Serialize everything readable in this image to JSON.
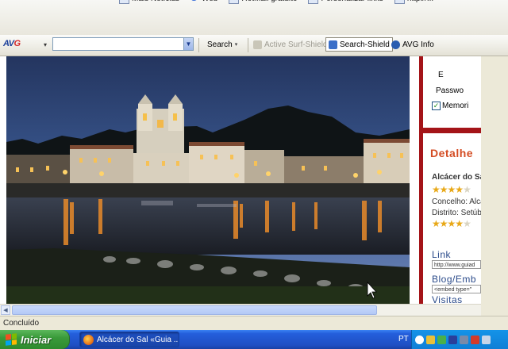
{
  "links_bar": {
    "items": [
      {
        "label": "Mais Notícias",
        "icon": "page-icon"
      },
      {
        "label": "Web",
        "icon": "google-icon"
      },
      {
        "label": "HotMail gratuito",
        "icon": "page-icon"
      },
      {
        "label": "Personalizar links",
        "icon": "page-icon"
      },
      {
        "label": "http://...",
        "icon": "page-icon"
      }
    ]
  },
  "toolbar": {
    "logo_prefix": "AV",
    "logo_suffix": "G",
    "logo_menu": "▾",
    "search_placeholder": "",
    "search_button": "Search",
    "surf_shield": "Active Surf-Shield",
    "search_shield": "Search-Shield",
    "avg_info": "AVG Info"
  },
  "sidebar": {
    "login_label_partial": "E",
    "password_label": "Passwo",
    "remember_label": "Memori",
    "remember_checked": true,
    "details_title": "Detalhe",
    "place_name": "Alcácer do Sa",
    "rating_1": 4,
    "concelho": "Concelho: Alca",
    "distrito": "Distrito: Setúb",
    "rating_2": 4,
    "rating_max": 5,
    "link_heading": "Link",
    "link_value": "http://www.guiad",
    "embed_heading": "Blog/Emb",
    "embed_value": "<embed type=\"",
    "visits_heading": "Visitas"
  },
  "statusbar": {
    "text": "Concluído"
  },
  "taskbar": {
    "start_label": "Iniciar",
    "window_title": "Alcácer do Sal «Guia ...",
    "language": "PT"
  },
  "colors": {
    "sidebar_red": "#a41418",
    "details_orange": "#d44d24",
    "xp_blue": "#245edb",
    "start_green": "#3a9a3a"
  }
}
